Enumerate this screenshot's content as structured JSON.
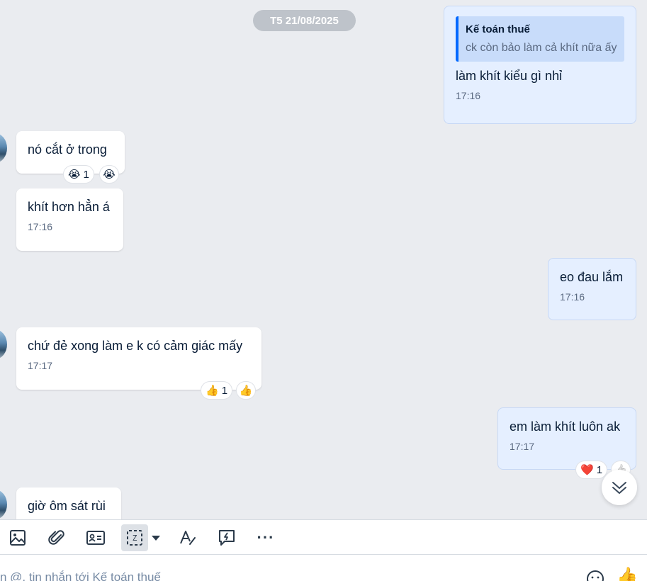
{
  "date_chip": "T5 21/08/2025",
  "messages": [
    {
      "side": "right",
      "quote": {
        "author": "Kế toán thuế",
        "text": "ck còn bảo làm cả khít nữa ấy"
      },
      "text": "làm khít kiểu gì nhỉ",
      "time": "17:16"
    },
    {
      "side": "left",
      "text": "nó cắt ở trong",
      "reaction": {
        "emoji": "😭",
        "count": "1",
        "quick": "😭"
      }
    },
    {
      "side": "left",
      "text": "khít hơn hẳn á",
      "time": "17:16"
    },
    {
      "side": "right",
      "text": "eo đau lắm",
      "time": "17:16"
    },
    {
      "side": "left",
      "text": "chứ đẻ xong làm e k có cảm giác mấy",
      "time": "17:17",
      "reaction": {
        "emoji": "👍",
        "count": "1",
        "quick": "👍"
      }
    },
    {
      "side": "right",
      "text": "em làm khít luôn ak",
      "time": "17:17",
      "reaction": {
        "emoji": "❤️",
        "count": "1",
        "quick": "👍"
      }
    },
    {
      "side": "left",
      "text": "giờ ôm sát rùi"
    }
  ],
  "toolbar": {
    "icons": [
      "image-icon",
      "attachment-icon",
      "contact-card-icon",
      "screenshot-icon",
      "dropdown-icon",
      "text-format-icon",
      "quick-message-icon",
      "more-icon"
    ],
    "more_label": "···"
  },
  "composer": {
    "placeholder": "n @, tin nhắn tới Kế toán thuế",
    "like_emoji": "👍"
  },
  "colors": {
    "accent": "#0068ff",
    "my_bubble": "#e5efff",
    "background": "#eaecf0"
  }
}
